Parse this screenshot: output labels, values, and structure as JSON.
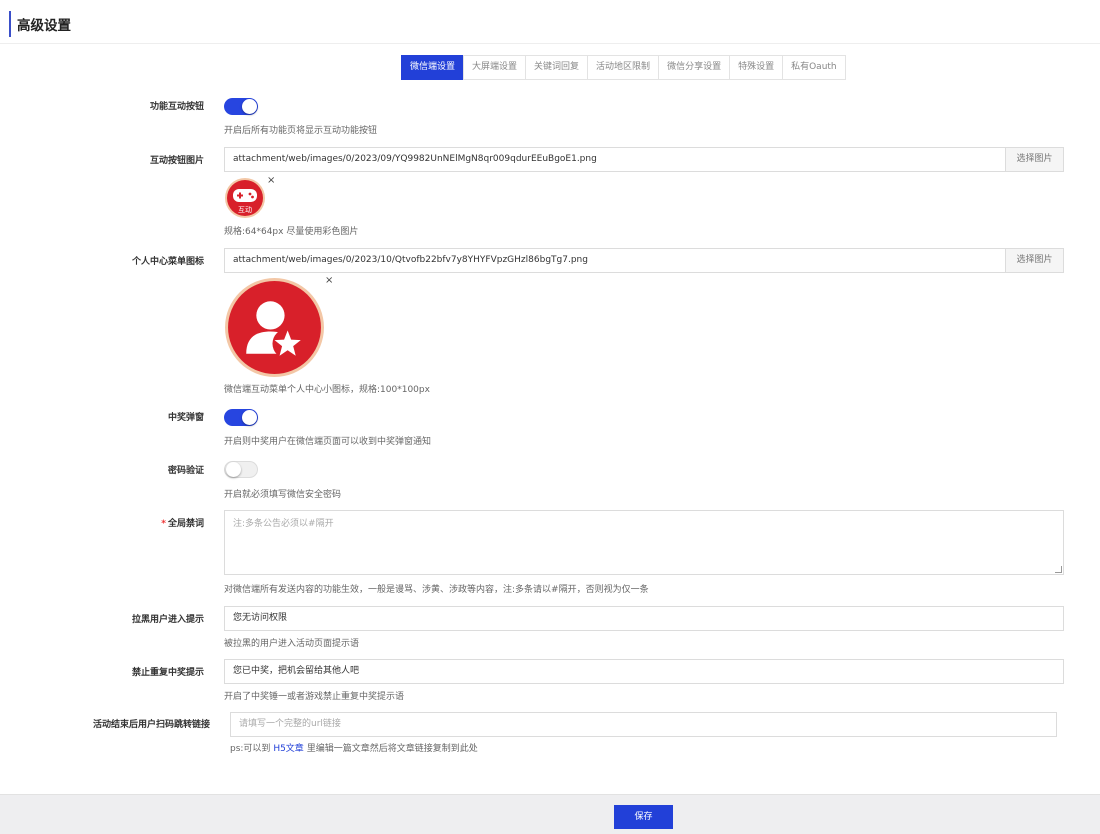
{
  "header": {
    "title": "高级设置"
  },
  "tabs": [
    {
      "label": "微信端设置",
      "active": true
    },
    {
      "label": "大屏端设置",
      "active": false
    },
    {
      "label": "关键词回复",
      "active": false
    },
    {
      "label": "活动地区限制",
      "active": false
    },
    {
      "label": "微信分享设置",
      "active": false
    },
    {
      "label": "特殊设置",
      "active": false
    },
    {
      "label": "私有Oauth",
      "active": false
    }
  ],
  "form": {
    "interact_button": {
      "label": "功能互动按钮",
      "enabled": true,
      "help": "开启后所有功能页将显示互动功能按钮"
    },
    "interact_image": {
      "label": "互动按钮图片",
      "value": "attachment/web/images/0/2023/09/YQ9982UnNElMgN8qr009qdurEEuBgoE1.png",
      "button": "选择图片",
      "remove": "×",
      "thumb_text": "互动",
      "help": "规格:64*64px 尽量使用彩色图片"
    },
    "center_icon": {
      "label": "个人中心菜单图标",
      "value": "attachment/web/images/0/2023/10/Qtvofb22bfv7y8YHYFVpzGHzl86bgTg7.png",
      "button": "选择图片",
      "remove": "×",
      "help": "微信端互动菜单个人中心小图标，规格:100*100px"
    },
    "prize_popup": {
      "label": "中奖弹窗",
      "enabled": true,
      "help": "开启则中奖用户在微信端页面可以收到中奖弹窗通知"
    },
    "password_verify": {
      "label": "密码验证",
      "enabled": false,
      "help": "开启就必须填写微信安全密码"
    },
    "global_ban": {
      "required_mark": "*",
      "label": "全局禁词",
      "placeholder": "注:多条公告必须以#隔开",
      "help": "对微信端所有发送内容的功能生效，一般是谩骂、涉黄、涉政等内容，注:多条请以#隔开，否则视为仅一条"
    },
    "blacklist_tip": {
      "label": "拉黑用户进入提示",
      "value": "您无访问权限",
      "help": "被拉黑的用户进入活动页面提示语"
    },
    "repeat_prize_tip": {
      "label": "禁止重复中奖提示",
      "value": "您已中奖，把机会留给其他人吧",
      "help": "开启了中奖锤一或者游戏禁止重复中奖提示语"
    },
    "end_redirect": {
      "label": "活动结束后用户扫码跳转链接",
      "placeholder": "请填写一个完整的url链接",
      "help_prefix": "ps:可以到",
      "help_link": "H5文章",
      "help_suffix": "里编辑一篇文章然后将文章链接复制到此处"
    }
  },
  "footer": {
    "save_label": "保存"
  },
  "colors": {
    "primary": "#2240d8",
    "badge_red": "#d8202a"
  }
}
